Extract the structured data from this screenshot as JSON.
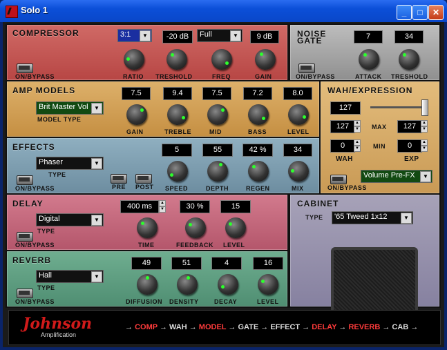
{
  "window": {
    "title": "Solo 1"
  },
  "compressor": {
    "title": "COMPRESSOR",
    "ratio_value": "3:1",
    "threshold_value": "-20 dB",
    "freq_value": "Full",
    "gain_value": "9 dB",
    "labels": {
      "ratio": "RATIO",
      "threshold": "TRESHOLD",
      "freq": "FREQ",
      "gain": "GAIN",
      "bypass": "ON/BYPASS"
    }
  },
  "noise_gate": {
    "title_line1": "NOISE",
    "title_line2": "GATE",
    "attack_value": "7",
    "threshold_value": "34",
    "labels": {
      "attack": "ATTACK",
      "threshold": "TRESHOLD",
      "bypass": "ON/BYPASS"
    }
  },
  "amp_models": {
    "title": "AMP MODELS",
    "model_type": "Brit Master Vol",
    "model_type_label": "MODEL TYPE",
    "values": [
      "7.5",
      "9.4",
      "7.5",
      "7.2",
      "8.0"
    ],
    "labels": {
      "gain": "GAIN",
      "treble": "TREBLE",
      "mid": "MID",
      "bass": "BASS",
      "level": "LEVEL"
    }
  },
  "wah": {
    "title": "WAH/EXPRESSION",
    "position": "127",
    "max_value": "127",
    "max_value2": "127",
    "wah_value": "0",
    "exp_value": "0",
    "labels": {
      "max": "MAX",
      "min": "MIN",
      "wah": "WAH",
      "exp": "EXP",
      "bypass": "ON/BYPASS"
    },
    "volume_mode": "Volume Pre-FX",
    "slider_level": 1.0
  },
  "effects": {
    "title": "EFFECTS",
    "type": "Phaser",
    "type_label": "TYPE",
    "values": [
      "5",
      "55",
      "42 %",
      "34"
    ],
    "labels": {
      "speed": "SPEED",
      "depth": "DEPTH",
      "regen": "REGEN",
      "mix": "MIX",
      "pre": "PRE",
      "post": "POST",
      "bypass": "ON/BYPASS"
    }
  },
  "delay": {
    "title": "DELAY",
    "type": "Digital",
    "type_label": "TYPE",
    "time_value": "400 ms",
    "feedback_value": "30 %",
    "level_value": "15",
    "labels": {
      "time": "TIME",
      "feedback": "FEEDBACK",
      "level": "LEVEL",
      "bypass": "ON/BYPASS"
    }
  },
  "cabinet": {
    "title": "CABINET",
    "type_label": "TYPE",
    "type": "'65 Tweed 1x12"
  },
  "reverb": {
    "title": "REVERB",
    "type": "Hall",
    "type_label": "TYPE",
    "values": [
      "49",
      "51",
      "4",
      "16"
    ],
    "labels": {
      "diffusion": "DIFFUSION",
      "density": "DENSITY",
      "decay": "DECAY",
      "level": "LEVEL",
      "bypass": "ON/BYPASS"
    }
  },
  "footer": {
    "brand": "Johnson",
    "brand_sub": "Amplification",
    "chain": [
      "COMP",
      "WAH",
      "MODEL",
      "GATE",
      "EFFECT",
      "DELAY",
      "REVERB",
      "CAB"
    ]
  },
  "colors": {
    "compressor": "#c4524f",
    "noise_gate": "#a8a8a8",
    "amp": "#d1a257",
    "wah": "#d9b070",
    "effects": "#7f9fb0",
    "delay": "#c8657a",
    "cabinet": "#9590a8",
    "reverb": "#5f9f82",
    "knob_dot": "#2dff2d"
  }
}
